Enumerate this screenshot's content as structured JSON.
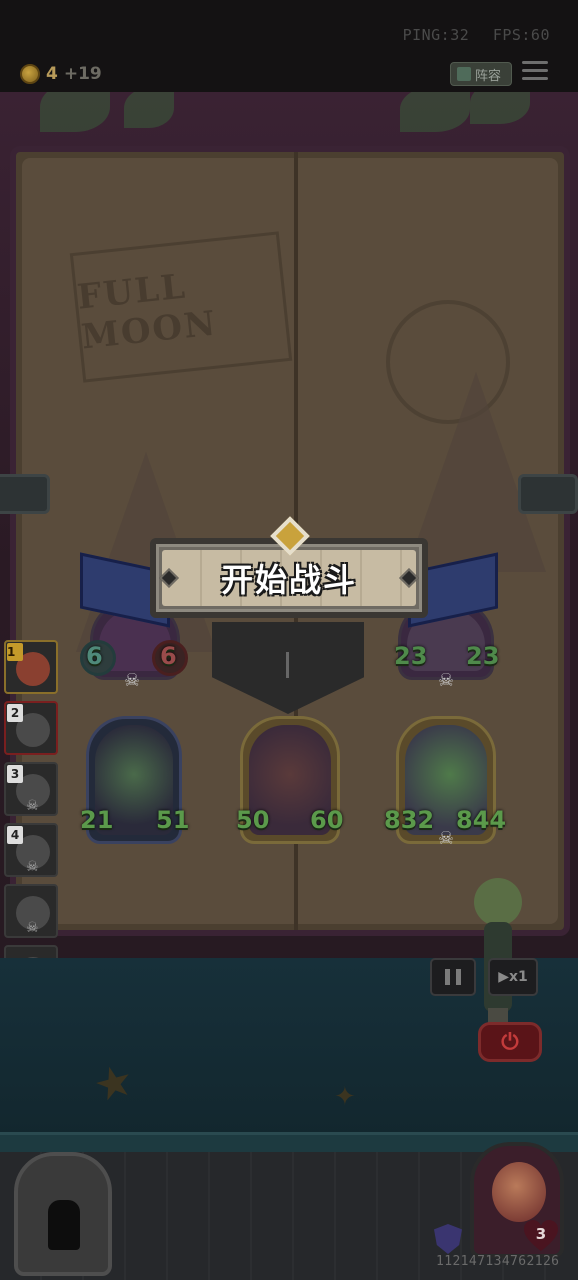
{
  "hud": {
    "ping": "PING:32",
    "fps": "FPS:60",
    "gold_amount": "4",
    "gold_income": "+19",
    "lineup_label": "阵容"
  },
  "book": {
    "sign_text": "FULL MOON"
  },
  "banner": {
    "title": "开始战斗"
  },
  "turn_queue": [
    {
      "number": "1",
      "state": "active"
    },
    {
      "number": "2",
      "state": "danger"
    },
    {
      "number": "3",
      "state": "normal"
    },
    {
      "number": "4",
      "state": "normal"
    },
    {
      "number": "",
      "state": "normal"
    },
    {
      "number": "",
      "state": "normal"
    },
    {
      "number": "",
      "state": "normal"
    },
    {
      "number": "",
      "state": "normal"
    }
  ],
  "enemy_units": [
    {
      "attack": "6",
      "health": "6"
    },
    {
      "attack": "23",
      "health": "23"
    }
  ],
  "player_units": [
    {
      "name": "horned-sorceress",
      "attack": "21",
      "health": "51"
    },
    {
      "name": "clockwork-beast",
      "attack": "50",
      "health": "60"
    },
    {
      "name": "green-cannon",
      "attack": "832",
      "health": "844"
    }
  ],
  "controls": {
    "speed_label": "▶x1"
  },
  "hero": {
    "lives": "3"
  },
  "game_id": "11214713476212​6"
}
